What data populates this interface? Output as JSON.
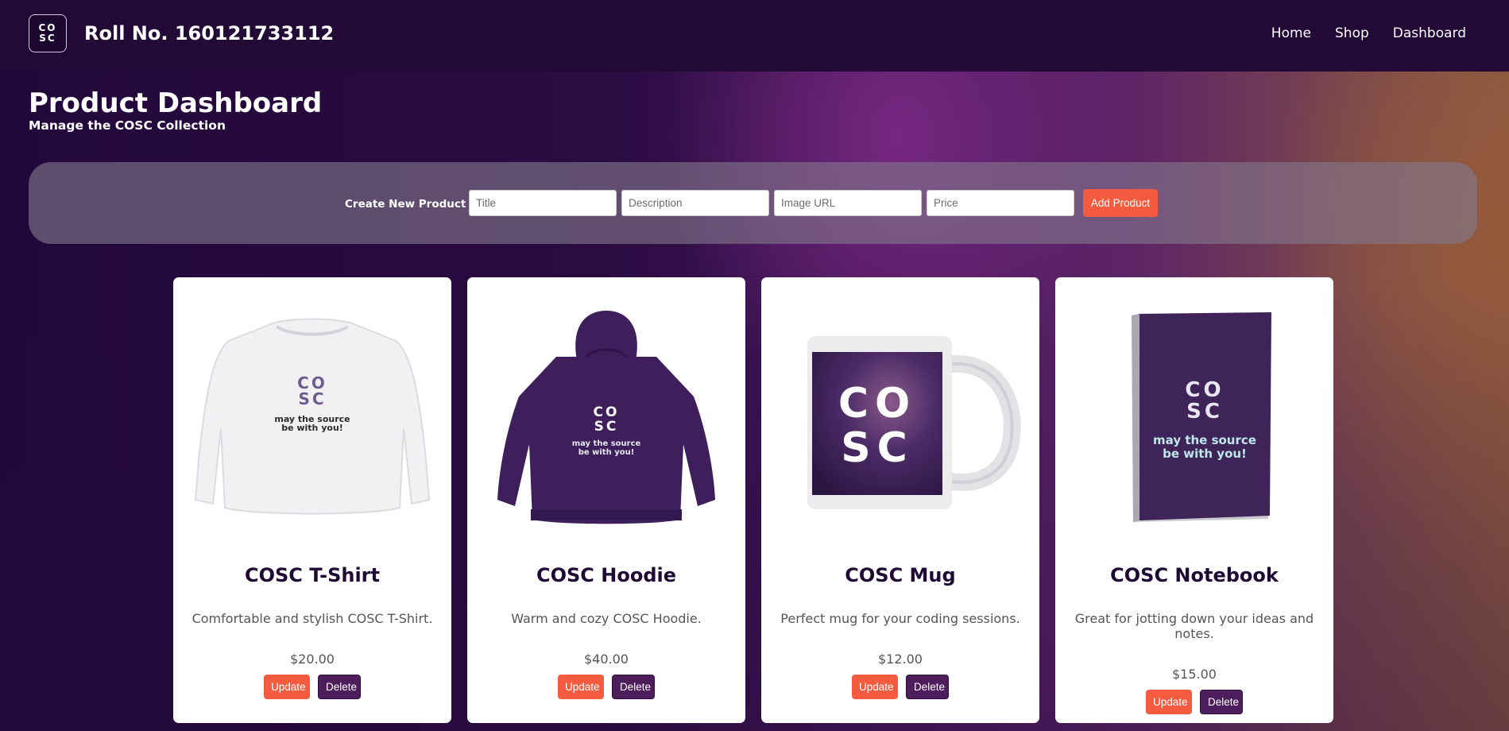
{
  "header": {
    "logo": {
      "line1": "CO",
      "line2": "SC"
    },
    "title": "Roll No. 160121733112",
    "nav": [
      "Home",
      "Shop",
      "Dashboard"
    ]
  },
  "page": {
    "title": "Product Dashboard",
    "subtitle": "Manage the COSC Collection"
  },
  "create_form": {
    "label": "Create New Product",
    "fields": [
      {
        "placeholder": "Title",
        "value": ""
      },
      {
        "placeholder": "Description",
        "value": ""
      },
      {
        "placeholder": "Image URL",
        "value": ""
      },
      {
        "placeholder": "Price",
        "value": ""
      }
    ],
    "submit_label": "Add Product"
  },
  "products": [
    {
      "title": "COSC T-Shirt",
      "description": "Comfortable and stylish COSC T-Shirt.",
      "price": "$20.00",
      "update_label": "Update",
      "delete_label": "Delete",
      "image": "sweatshirt-icon"
    },
    {
      "title": "COSC Hoodie",
      "description": "Warm and cozy COSC Hoodie.",
      "price": "$40.00",
      "update_label": "Update",
      "delete_label": "Delete",
      "image": "hoodie-icon"
    },
    {
      "title": "COSC Mug",
      "description": "Perfect mug for your coding sessions.",
      "price": "$12.00",
      "update_label": "Update",
      "delete_label": "Delete",
      "image": "mug-icon"
    },
    {
      "title": "COSC Notebook",
      "description": "Great for jotting down your ideas and notes.",
      "price": "$15.00",
      "update_label": "Update",
      "delete_label": "Delete",
      "image": "notebook-icon"
    }
  ],
  "colors": {
    "header_bg": "#230936",
    "accent_update": "#f45b3f",
    "accent_delete": "#4e1d5c",
    "product_purple": "#3e1f5c"
  },
  "product_art_text": {
    "brand_line1": "CO",
    "brand_line2": "SC",
    "slogan_line1": "may the source",
    "slogan_line2": "be with you!"
  }
}
